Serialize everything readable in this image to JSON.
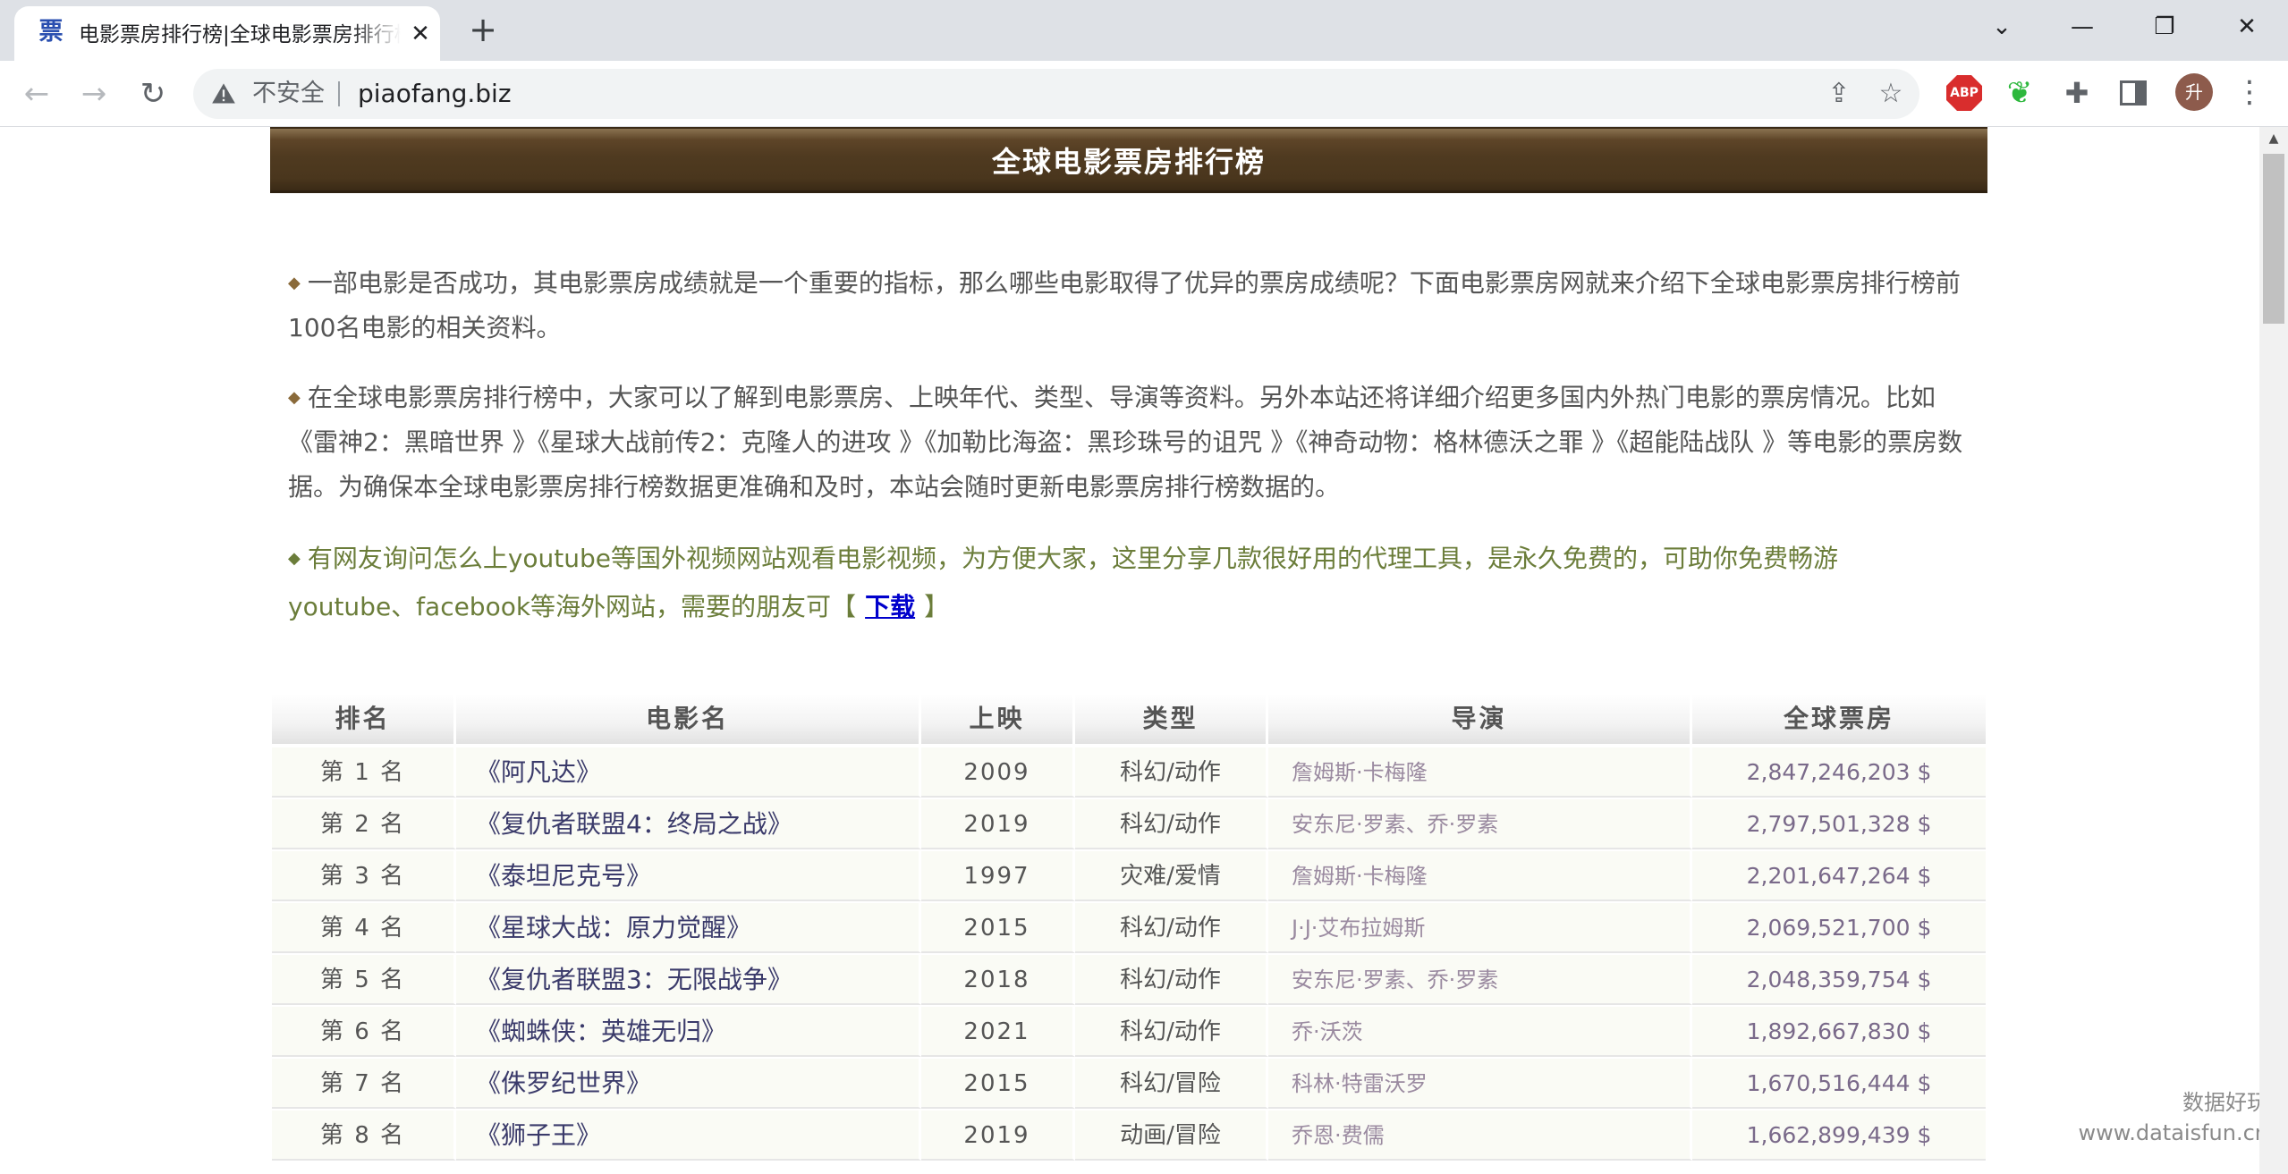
{
  "browser": {
    "tab": {
      "favicon": "票",
      "title": "电影票房排行榜|全球电影票房排行榜",
      "close": "✕"
    },
    "new_tab": "+",
    "window_controls": {
      "chevron": "⌄",
      "minimize": "—",
      "restore": "❐",
      "close": "✕"
    },
    "nav": {
      "back": "←",
      "forward": "→",
      "reload": "↻"
    },
    "omnibox": {
      "security_label": "不安全",
      "url": "piaofang.biz",
      "share_icon": "⇪",
      "bookmark_icon": "☆"
    },
    "extensions": {
      "abp_label": "ABP",
      "evernote": "❦",
      "puzzle": "✚"
    },
    "avatar_initial": "升",
    "menu": "⋮",
    "colors": {
      "tabstrip": "#dee1e6",
      "omnibox": "#f1f3f4",
      "avatar": "#8d5b4c"
    }
  },
  "page": {
    "banner_title": "全球电影票房排行榜",
    "bullet": "◆",
    "paragraphs": [
      "一部电影是否成功，其电影票房成绩就是一个重要的指标，那么哪些电影取得了优异的票房成绩呢？下面电影票房网就来介绍下全球电影票房排行榜前100名电影的相关资料。",
      "在全球电影票房排行榜中，大家可以了解到电影票房、上映年代、类型、导演等资料。另外本站还将详细介绍更多国内外热门电影的票房情况。比如《雷神2：黑暗世界 》《星球大战前传2：克隆人的进攻 》《加勒比海盗：黑珍珠号的诅咒 》《神奇动物：格林德沃之罪 》《超能陆战队 》等电影的票房数据。为确保本全球电影票房排行榜数据更准确和及时，本站会随时更新电影票房排行榜数据的。"
    ],
    "proxy_note": {
      "text": "有网友询问怎么上youtube等国外视频网站观看电影视频，为方便大家，这里分享几款很好用的代理工具，是永久免费的，可助你免费畅游 youtube、facebook等海外网站，需要的朋友可",
      "bracket_open": "【",
      "link_label": "下载",
      "bracket_close": "】"
    },
    "table": {
      "headers": [
        "排名",
        "电影名",
        "上映",
        "类型",
        "导演",
        "全球票房"
      ],
      "rows": [
        {
          "rank": "第 1 名",
          "title": "《阿凡达》",
          "year": "2009",
          "genre": "科幻/动作",
          "director": "詹姆斯·卡梅隆",
          "gross": "2,847,246,203 $"
        },
        {
          "rank": "第 2 名",
          "title": "《复仇者联盟4：终局之战》",
          "year": "2019",
          "genre": "科幻/动作",
          "director": "安东尼·罗素、乔·罗素",
          "gross": "2,797,501,328 $"
        },
        {
          "rank": "第 3 名",
          "title": "《泰坦尼克号》",
          "year": "1997",
          "genre": "灾难/爱情",
          "director": "詹姆斯·卡梅隆",
          "gross": "2,201,647,264 $"
        },
        {
          "rank": "第 4 名",
          "title": "《星球大战：原力觉醒》",
          "year": "2015",
          "genre": "科幻/动作",
          "director": "J·J·艾布拉姆斯",
          "gross": "2,069,521,700 $"
        },
        {
          "rank": "第 5 名",
          "title": "《复仇者联盟3：无限战争》",
          "year": "2018",
          "genre": "科幻/动作",
          "director": "安东尼·罗素、乔·罗素",
          "gross": "2,048,359,754 $"
        },
        {
          "rank": "第 6 名",
          "title": "《蜘蛛侠：英雄无归》",
          "year": "2021",
          "genre": "科幻/动作",
          "director": "乔·沃茨",
          "gross": "1,892,667,830 $"
        },
        {
          "rank": "第 7 名",
          "title": "《侏罗纪世界》",
          "year": "2015",
          "genre": "科幻/冒险",
          "director": "科林·特雷沃罗",
          "gross": "1,670,516,444 $"
        },
        {
          "rank": "第 8 名",
          "title": "《狮子王》",
          "year": "2019",
          "genre": "动画/冒险",
          "director": "乔恩·费儒",
          "gross": "1,662,899,439 $"
        }
      ]
    },
    "watermark": {
      "line1": "数据好玩",
      "line2": "www.dataisfun.cn"
    },
    "colors": {
      "banner": "#4f3a20",
      "row_bg": "#fafbf5",
      "link": "#0000cc",
      "note_green": "#6b7d3a"
    }
  }
}
